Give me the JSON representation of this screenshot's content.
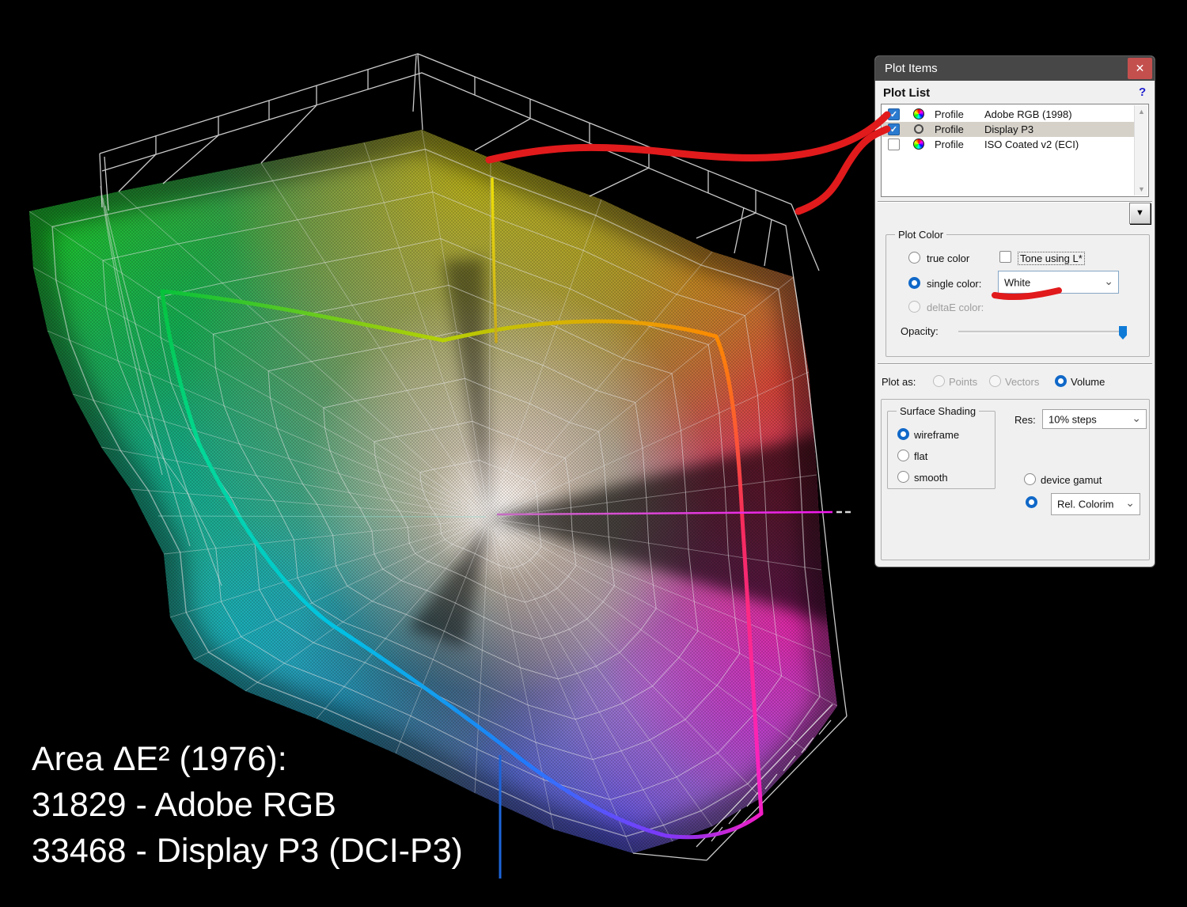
{
  "overlay_text": {
    "title": "Area ΔE² (1976):",
    "adobe_rgb": "31829 - Adobe RGB",
    "display_p3": "33468 - Display P3 (DCI-P3)"
  },
  "dialog": {
    "title": "Plot Items",
    "plot_list": {
      "heading": "Plot List",
      "help_glyph": "?",
      "rows": [
        {
          "checked": true,
          "icon": "color-wheel-icon",
          "type_label": "Profile",
          "name": "Adobe RGB (1998)",
          "selected": false
        },
        {
          "checked": true,
          "icon": "circle-outline-icon",
          "type_label": "Profile",
          "name": "Display P3",
          "selected": true
        },
        {
          "checked": false,
          "icon": "color-wheel-icon",
          "type_label": "Profile",
          "name": "ISO Coated v2 (ECI)",
          "selected": false
        }
      ]
    },
    "plot_color": {
      "group_label": "Plot Color",
      "true_color_label": "true color",
      "tone_label": "Tone using L*",
      "single_color_label": "single color:",
      "single_color_value": "White",
      "deltae_label": "deltaE color:",
      "opacity_label": "Opacity:",
      "opacity_value_percent": 100
    },
    "plot_as": {
      "label": "Plot as:",
      "options": [
        "Points",
        "Vectors",
        "Volume"
      ],
      "selected": "Volume"
    },
    "surface_shading": {
      "group_label": "Surface Shading",
      "options": [
        "wireframe",
        "flat",
        "smooth"
      ],
      "selected": "wireframe"
    },
    "resolution": {
      "label": "Res:",
      "value": "10% steps"
    },
    "gamut_mapping": {
      "device_gamut_label": "device gamut",
      "intent_value": "Rel. Colorim"
    }
  },
  "icons": {
    "close": "✕",
    "check": "✓",
    "drop_arrow": "▼",
    "chevron": "⌄",
    "scroll_up": "▲",
    "scroll_down": "▼"
  },
  "colors": {
    "annotation_red": "#e11a1c",
    "axis_magenta": "#f516f0",
    "neutral_line_blue": "#1c64d8",
    "dialog_titlebar": "#474747",
    "close_button_red": "#c4504e",
    "selection_blue": "#1068c8",
    "selected_row_gray": "#d5d1c9"
  }
}
